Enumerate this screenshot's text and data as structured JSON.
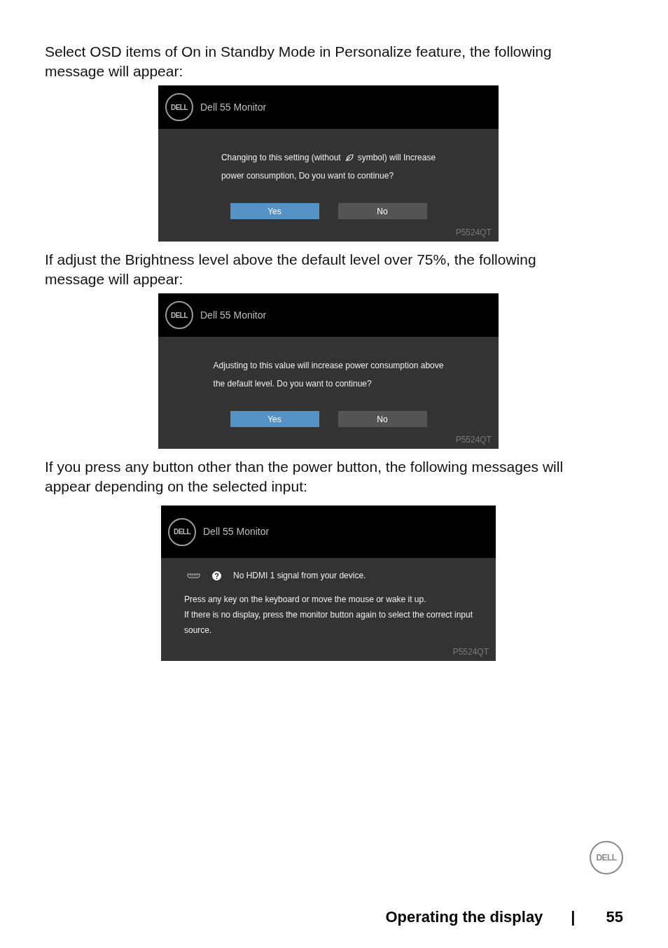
{
  "sections": [
    {
      "paragraph": "Select OSD items of On in Standby Mode in Personalize feature, the following message will appear:",
      "dialog": {
        "kind": "confirm",
        "logo": "DELL",
        "title": "Dell 55 Monitor",
        "model": "P5524QT",
        "lines": [
          {
            "segments": [
              {
                "kind": "text",
                "text": "Changing to this setting (without"
              },
              {
                "kind": "icon"
              },
              {
                "kind": "text",
                "text": "symbol) will Increase"
              }
            ]
          },
          {
            "segments": [
              {
                "kind": "text",
                "text": "power consumption, Do you want to continue?"
              }
            ]
          }
        ],
        "buttons": [
          {
            "label": "Yes",
            "selected": true
          },
          {
            "label": "No",
            "selected": false
          }
        ]
      }
    },
    {
      "paragraph": "If adjust the Brightness level above the default level over 75%, the following message will appear:",
      "dialog": {
        "kind": "confirm",
        "logo": "DELL",
        "title": "Dell 55 Monitor",
        "model": "P5524QT",
        "lines": [
          {
            "segments": [
              {
                "kind": "text",
                "text": "Adjusting to this value will increase power consumption above"
              }
            ]
          },
          {
            "segments": [
              {
                "kind": "text",
                "text": "the default level. Do you want to continue?"
              }
            ]
          }
        ],
        "buttons": [
          {
            "label": "Yes",
            "selected": true
          },
          {
            "label": "No",
            "selected": false
          }
        ]
      }
    },
    {
      "paragraph": "If you press any button other than the power button, the following messages will appear depending on the selected input:",
      "dialog": {
        "kind": "no_signal",
        "logo": "DELL",
        "title": "Dell 55 Monitor",
        "model": "P5524QT",
        "status": "No HDMI 1 signal from your device.",
        "lines": [
          "Press any key on the keyboard or move the mouse or wake it up.",
          "If there is no display, press the monitor button again to select the correct input source."
        ]
      }
    }
  ],
  "footer": {
    "logo": "DELL",
    "title": "Operating the display",
    "separator": "|",
    "page": "55"
  }
}
